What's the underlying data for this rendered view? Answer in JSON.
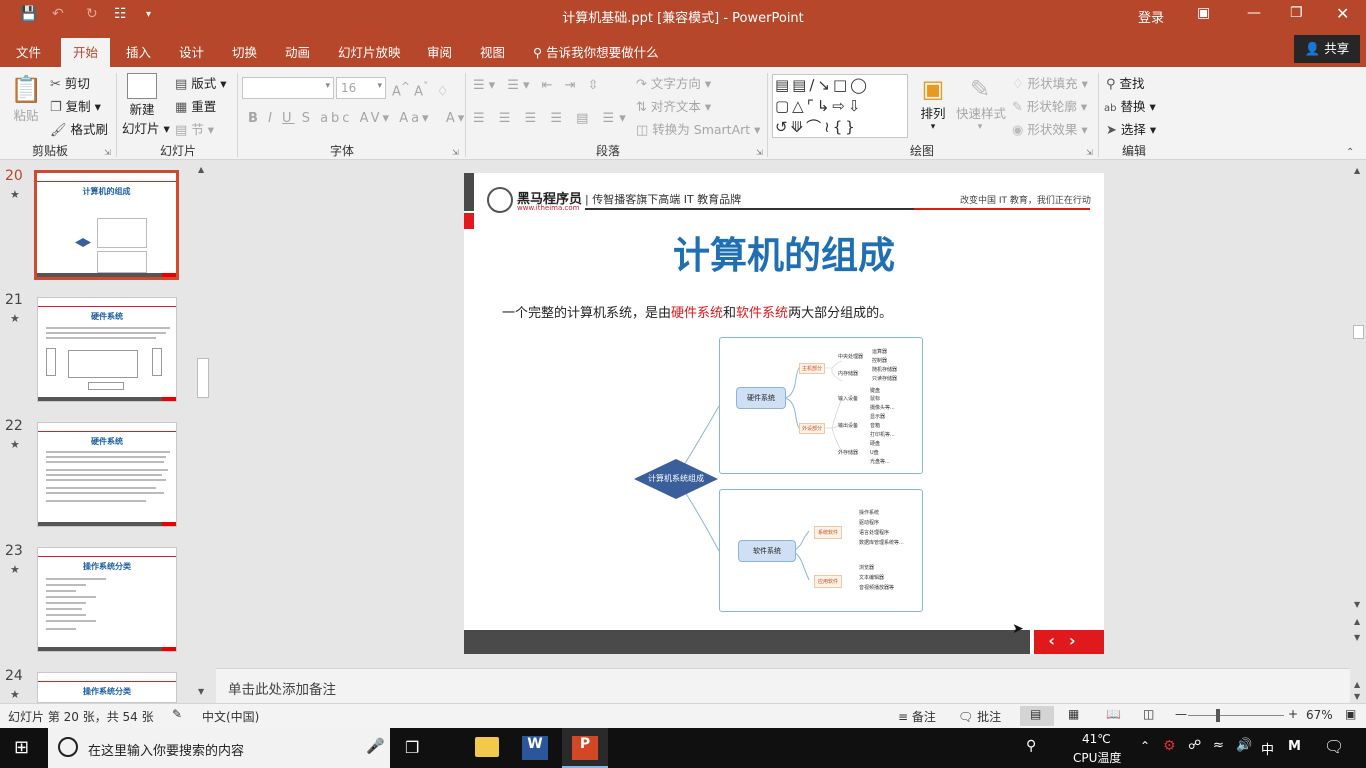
{
  "window": {
    "title": "计算机基础.ppt [兼容模式]  -  PowerPoint",
    "login": "登录"
  },
  "tabs": [
    "文件",
    "开始",
    "插入",
    "设计",
    "切换",
    "动画",
    "幻灯片放映",
    "审阅",
    "视图"
  ],
  "active_tab": "开始",
  "tell_me": "告诉我你想要做什么",
  "share": "共享",
  "ribbon": {
    "clipboard": {
      "paste": "粘贴",
      "cut": "剪切",
      "copy": "复制",
      "format_painter": "格式刷",
      "group": "剪贴板"
    },
    "slides": {
      "new_slide": "新建",
      "new_slide2": "幻灯片",
      "layout": "版式",
      "reset": "重置",
      "section": "节",
      "group": "幻灯片"
    },
    "font": {
      "size": "16",
      "group": "字体"
    },
    "paragraph": {
      "text_direction": "文字方向",
      "align_text": "对齐文本",
      "smartart": "转换为 SmartArt",
      "group": "段落"
    },
    "drawing": {
      "arrange": "排列",
      "quick_styles": "快速样式",
      "shape_fill": "形状填充",
      "shape_outline": "形状轮廓",
      "shape_effects": "形状效果",
      "group": "绘图"
    },
    "editing": {
      "find": "查找",
      "replace": "替换",
      "select": "选择",
      "group": "编辑"
    }
  },
  "thumbnails": [
    {
      "num": "20",
      "title": "计算机的组成",
      "selected": true
    },
    {
      "num": "21",
      "title": "硬件系统",
      "selected": false
    },
    {
      "num": "22",
      "title": "硬件系统",
      "selected": false
    },
    {
      "num": "23",
      "title": "操作系统分类",
      "selected": false
    },
    {
      "num": "24",
      "title": "操作系统分类",
      "selected": false
    }
  ],
  "slide": {
    "logo_name": "黑马程序员",
    "logo_url": "www.itheima.com",
    "tagline": "| 传智播客旗下高端 IT 教育品牌",
    "slogan": "改变中国 IT 教育，我们正在行动",
    "title": "计算机的组成",
    "body_pre": "一个完整的计算机系统，是由",
    "body_hw": "硬件系统",
    "body_and": "和",
    "body_sw": "软件系统",
    "body_post": "两大部分组成的。",
    "diagram": {
      "root": "计算机系统组成",
      "hardware": "硬件系统",
      "host": "主机部分",
      "cpu": "中央处理器",
      "cpu_items": [
        "运算器",
        "控制器"
      ],
      "memory": "内存储器",
      "memory_items": [
        "随机存储器",
        "只读存储器"
      ],
      "peripheral": "外设部分",
      "input": "输入设备",
      "input_items": [
        "键盘",
        "鼠标",
        "摄像头等..."
      ],
      "output": "输出设备",
      "output_items": [
        "显示器",
        "音箱",
        "打印机等..."
      ],
      "external": "外存储器",
      "external_items": [
        "硬盘",
        "U盘",
        "光盘等..."
      ],
      "software": "软件系统",
      "system_sw": "系统软件",
      "system_items": [
        "操作系统",
        "驱动程序",
        "语言处理程序",
        "数据库管理系统等..."
      ],
      "app_sw": "应用软件",
      "app_items": [
        "浏览器",
        "文本编辑器",
        "音视频播放器等"
      ]
    }
  },
  "notes_placeholder": "单击此处添加备注",
  "status": {
    "slide_info": "幻灯片 第 20 张，共 54 张",
    "language": "中文(中国)",
    "notes": "备注",
    "comments": "批注",
    "zoom": "67%"
  },
  "taskbar": {
    "search": "在这里输入你要搜索的内容",
    "temp": "41℃",
    "cpu": "CPU温度",
    "ime": "中",
    "ime2": "M"
  },
  "colors": {
    "accent": "#b7472a",
    "slide_title": "#1f6fb2",
    "highlight_red": "#e0191c"
  }
}
